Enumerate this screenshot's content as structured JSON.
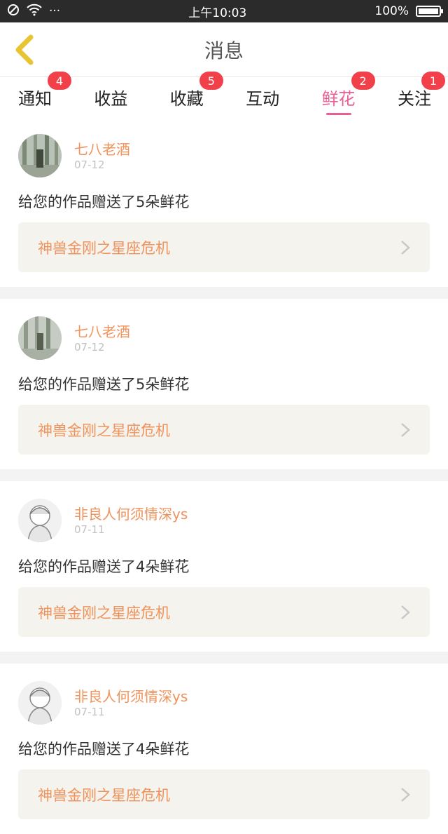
{
  "status_bar": {
    "time": "上午10:03",
    "battery": "100%",
    "dots": "···"
  },
  "navbar": {
    "title": "消息"
  },
  "tabs": [
    {
      "label": "通知",
      "badge": "4"
    },
    {
      "label": "收益",
      "badge": ""
    },
    {
      "label": "收藏",
      "badge": "5"
    },
    {
      "label": "互动",
      "badge": ""
    },
    {
      "label": "鲜花",
      "badge": "2"
    },
    {
      "label": "关注",
      "badge": "1"
    }
  ],
  "messages": [
    {
      "user": "七八老酒",
      "date": "07-12",
      "text": "给您的作品赠送了5朵鲜花",
      "work": "神兽金刚之星座危机"
    },
    {
      "user": "七八老酒",
      "date": "07-12",
      "text": "给您的作品赠送了5朵鲜花",
      "work": "神兽金刚之星座危机"
    },
    {
      "user": "非良人何须情深ys",
      "date": "07-11",
      "text": "给您的作品赠送了4朵鲜花",
      "work": "神兽金刚之星座危机"
    },
    {
      "user": "非良人何须情深ys",
      "date": "07-11",
      "text": "给您的作品赠送了4朵鲜花",
      "work": "神兽金刚之星座危机"
    }
  ],
  "colors": {
    "accent": "#e95f94",
    "badge": "#f2404a",
    "link_text": "#f0925b",
    "back_arrow": "#e8c332"
  },
  "icons": {
    "back": "chevron-left-icon",
    "chevron": "chevron-right-icon",
    "wifi": "wifi-icon",
    "dnd": "do-not-disturb-icon",
    "battery": "battery-icon"
  }
}
